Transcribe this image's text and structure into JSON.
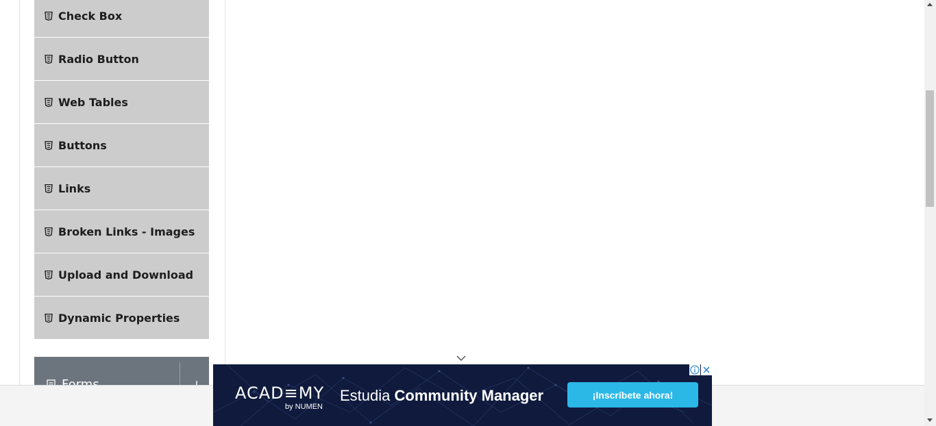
{
  "sidebar": {
    "items": [
      {
        "label": "Check Box",
        "icon": "html5-icon"
      },
      {
        "label": "Radio Button",
        "icon": "html5-icon"
      },
      {
        "label": "Web Tables",
        "icon": "html5-icon"
      },
      {
        "label": "Buttons",
        "icon": "html5-icon"
      },
      {
        "label": "Links",
        "icon": "html5-icon"
      },
      {
        "label": "Broken Links - Images",
        "icon": "html5-icon"
      },
      {
        "label": "Upload and Download",
        "icon": "html5-icon"
      },
      {
        "label": "Dynamic Properties",
        "icon": "html5-icon"
      }
    ],
    "group": {
      "title": "Forms",
      "icon": "list-icon",
      "toggle_icon": "arrow-down-icon"
    }
  },
  "ad": {
    "brand": "ACAD≡MY",
    "brand_sub": "by NUMEN",
    "headline_prefix": "Estudia ",
    "headline_bold": "Community Manager",
    "cta_label": "¡Inscríbete ahora!",
    "background_color": "#0f1a3d",
    "cta_color": "#2cb8e6"
  },
  "colors": {
    "menu_item_bg": "#cccccc",
    "group_header_bg": "#6c757d"
  }
}
